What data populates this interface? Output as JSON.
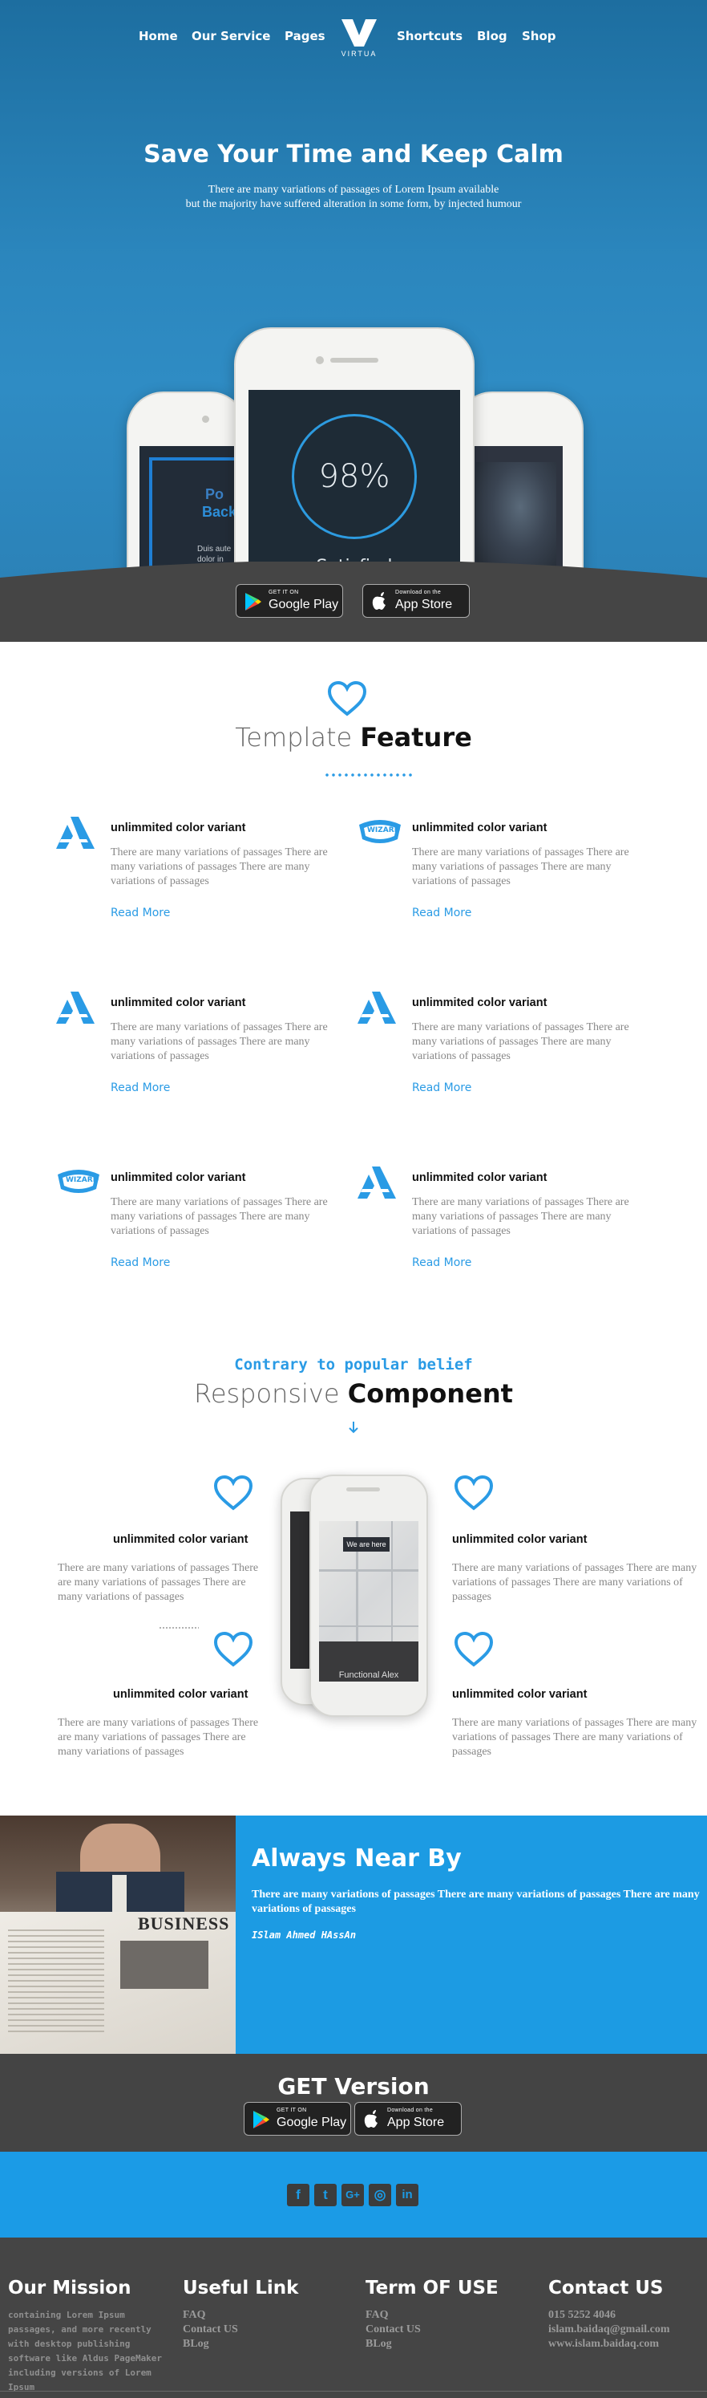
{
  "nav": {
    "items": [
      "Home",
      "Our Service",
      "Pages",
      "Shortcuts",
      "Blog",
      "Shop"
    ],
    "logo_text": "VIRTUA"
  },
  "hero": {
    "title": "Save Your Time and Keep Calm",
    "subtitle_line1": "There are many variations of passages of Lorem Ipsum available",
    "subtitle_line2": "but the majority have suffered alteration in some form, by injected humour",
    "phone_main": {
      "percent": "98%",
      "label": "Satisfied"
    },
    "phone_left": {
      "line1": "Po",
      "line2": "Back",
      "small1": "Duis aute",
      "small2": "dolor in"
    }
  },
  "stores": {
    "google_small": "GET IT ON",
    "google_big": "Google Play",
    "apple_small": "Download on the",
    "apple_big": "App Store"
  },
  "features": {
    "title_light": "Template",
    "title_bold": "Feature",
    "items": [
      {
        "icon": "triangle-logo-icon",
        "title": "unlimmited color variant",
        "text": "There are many variations of passages There are many variations of passages There are many variations of passages",
        "more": "Read More"
      },
      {
        "icon": "wizard-badge-icon",
        "title": "unlimmited color variant",
        "text": "There are many variations of passages There are many variations of passages There are many variations of passages",
        "more": "Read More"
      },
      {
        "icon": "triangle-logo-icon",
        "title": "unlimmited color variant",
        "text": "There are many variations of passages There are many variations of passages There are many variations of passages",
        "more": "Read More"
      },
      {
        "icon": "triangle-logo-icon",
        "title": "unlimmited color variant",
        "text": "There are many variations of passages There are many variations of passages There are many variations of passages",
        "more": "Read More"
      },
      {
        "icon": "wizard-badge-icon",
        "title": "unlimmited color variant",
        "text": "There are many variations of passages There are many variations of passages There are many variations of passages",
        "more": "Read More"
      },
      {
        "icon": "triangle-logo-icon",
        "title": "unlimmited color variant",
        "text": "There are many variations of passages There are many variations of passages There are many variations of passages",
        "more": "Read More"
      }
    ],
    "wizard_badge_text": "WIZARD"
  },
  "responsive": {
    "kicker": "Contrary to popular belief",
    "title_light": "Responsive",
    "title_bold": "Component",
    "items": [
      {
        "title": "unlimmited color variant",
        "text": "There are many variations of passages There are many variations of passages There are many variations of passages"
      },
      {
        "title": "unlimmited color variant",
        "text": "There are many variations of passages There are many variations of passages There are many variations of passages"
      },
      {
        "title": "unlimmited color variant",
        "text": "There are many variations of passages There are many variations of passages There are many variations of passages"
      },
      {
        "title": "unlimmited color variant",
        "text": "There are many variations of passages There are many variations of passages There are many variations of passages"
      }
    ],
    "phone_pin": "We are here",
    "phone_footer": "Functional Alex"
  },
  "near": {
    "title_light": "Always",
    "title_bold": "Near By",
    "text": "There are many variations of passages There are many variations of passages There are many variations of passages",
    "author": "ISlam Ahmed HAssAn",
    "newspaper_word": "BUSINESS"
  },
  "get_version": {
    "title_light": "GET",
    "title_bold": "Version"
  },
  "social": {
    "icons": [
      "facebook-icon",
      "twitter-icon",
      "google-plus-icon",
      "instagram-icon",
      "linkedin-icon"
    ],
    "glyphs": [
      "f",
      "t",
      "G+",
      "◎",
      "in"
    ]
  },
  "footer": {
    "mission_title": "Our Mission",
    "mission_text": "containing Lorem Ipsum passages, and more recently with desktop publishing software like Aldus PageMaker including versions of Lorem Ipsum",
    "useful_title": "Useful Link",
    "useful_links": [
      "FAQ",
      "Contact US",
      "BLog"
    ],
    "terms_title": "Term OF USE",
    "terms_links": [
      "FAQ",
      "Contact US",
      "BLog"
    ],
    "contact_title": "Contact US",
    "contact_lines": [
      "015 5252 4046",
      "islam.baidaq@gmail.com",
      "www.islam.baidaq.com"
    ]
  },
  "colors": {
    "accent": "#2a9be5",
    "hero": "#2b86bd",
    "dark": "#454545"
  }
}
